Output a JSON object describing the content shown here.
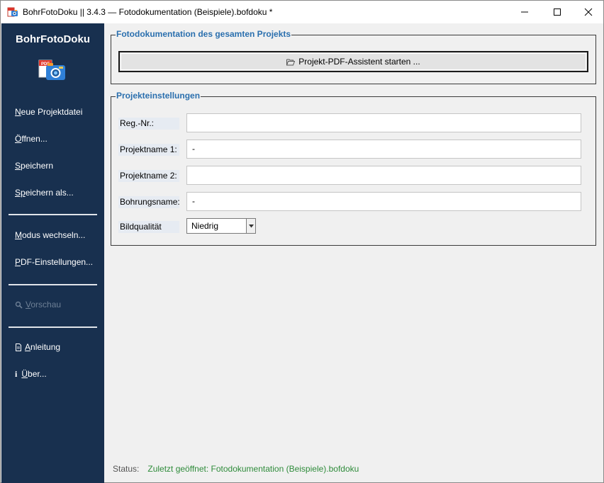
{
  "window": {
    "title": "BohrFotoDoku || 3.4.3 — Fotodokumentation (Beispiele).bofdoku *"
  },
  "sidebar": {
    "brand": "BohrFotoDoku",
    "items": [
      {
        "label_u": "N",
        "label_rest": "eue Projektdatei"
      },
      {
        "label_u": "Ö",
        "label_rest": "ffnen..."
      },
      {
        "label_u": "S",
        "label_rest": "peichern"
      },
      {
        "label_u": "Sp",
        "label_rest": "eichern als..."
      },
      {
        "label_u": "M",
        "label_rest": "odus wechseln..."
      },
      {
        "label_u": "P",
        "label_rest": "DF-Einstellungen..."
      },
      {
        "label_u": "V",
        "label_rest": "orschau"
      },
      {
        "label_u": "A",
        "label_rest": "nleitung"
      },
      {
        "label_u": "Ü",
        "label_rest": "ber..."
      }
    ],
    "icons": {
      "preview": "magnifier-icon",
      "manual": "document-icon",
      "about": "info-icon"
    },
    "about_icon_glyph": "i"
  },
  "photo_section": {
    "title": "Fotodokumentation des gesamten Projekts",
    "button_label": "Projekt-PDF-Assistent starten ...",
    "button_icon": "folder-open-icon"
  },
  "settings": {
    "title": "Projekteinstellungen",
    "fields": [
      {
        "label": "Reg.-Nr.:",
        "value": ""
      },
      {
        "label": "Projektname 1:",
        "value": "-"
      },
      {
        "label": "Projektname 2:",
        "value": ""
      },
      {
        "label": "Bohrungsname:",
        "value": "-"
      }
    ],
    "quality": {
      "label": "Bildqualität",
      "value": "Niedrig"
    }
  },
  "status": {
    "label": "Status:",
    "value": "Zuletzt geöffnet: Fotodokumentation (Beispiele).bofdoku"
  },
  "colors": {
    "sidebar_bg": "#18304f",
    "group_title": "#2a6fae",
    "status_value": "#2e8b3a"
  }
}
